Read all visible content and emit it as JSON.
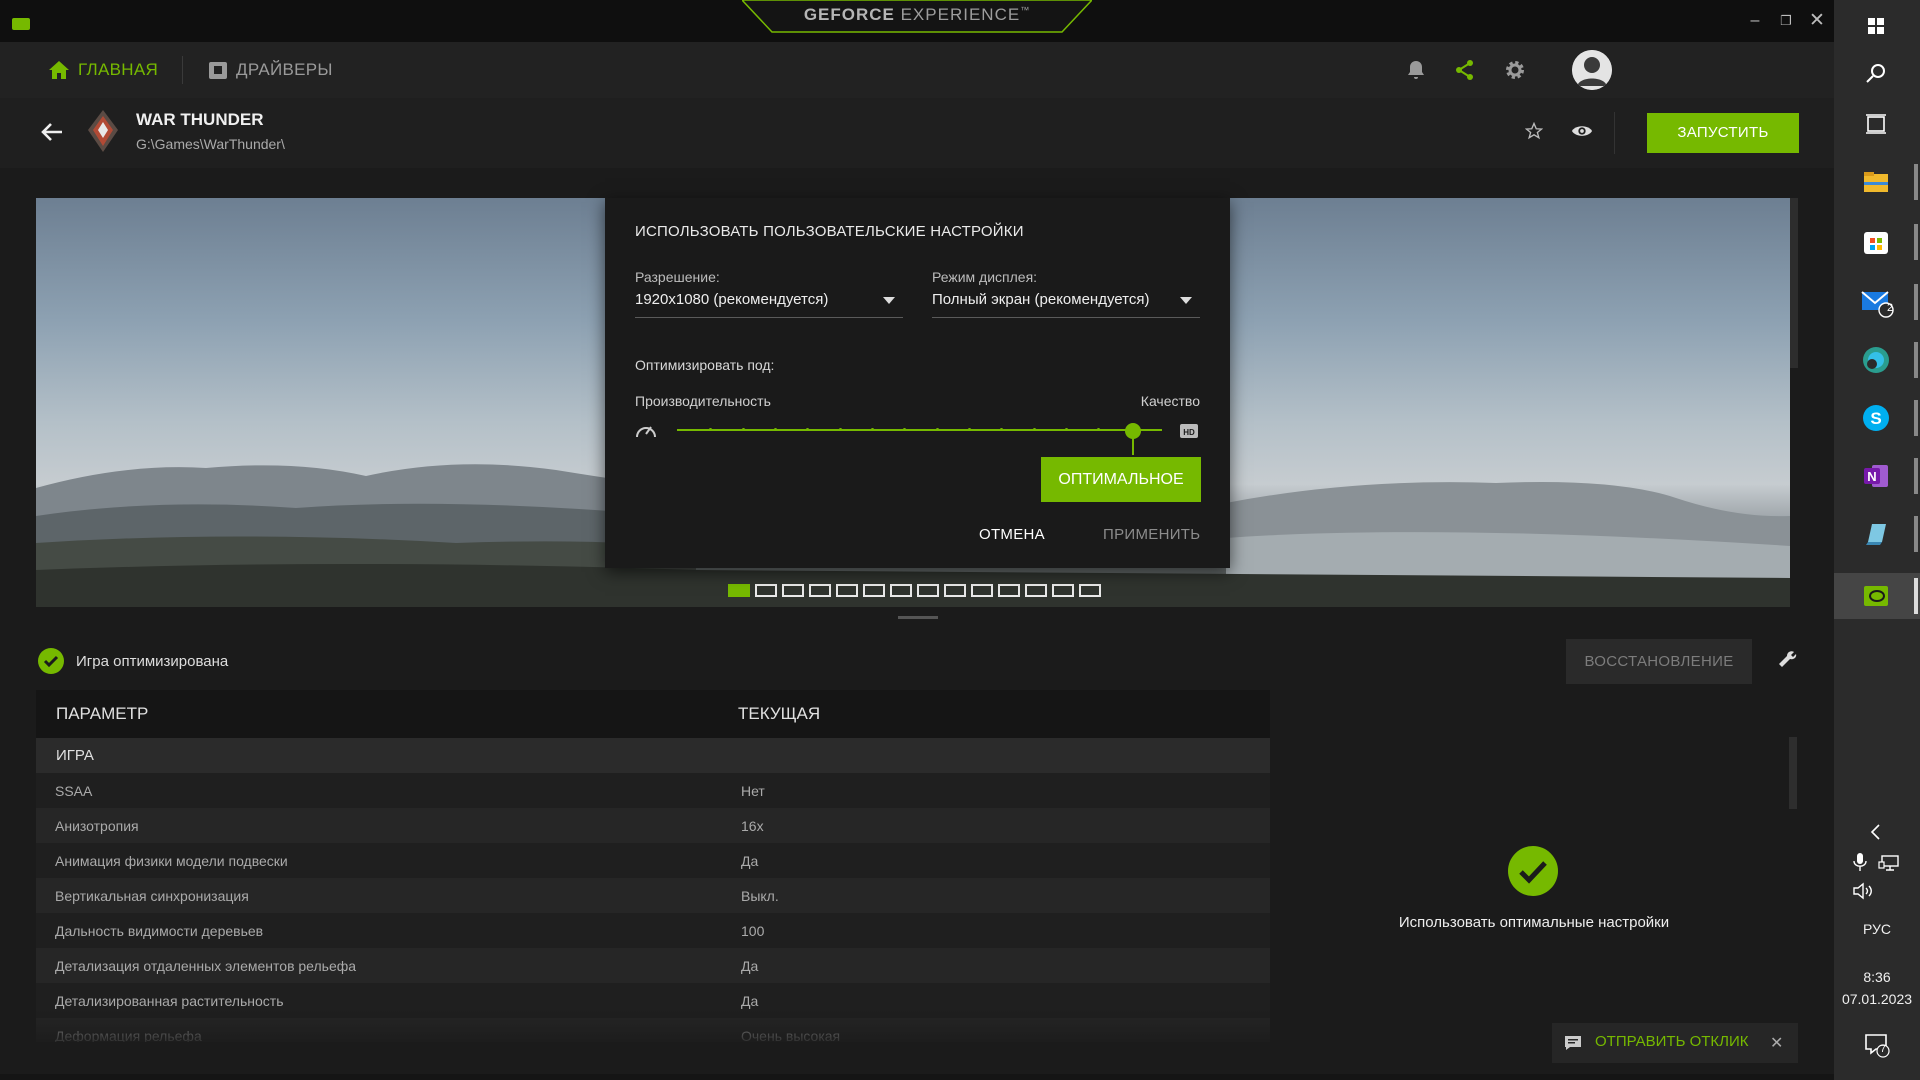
{
  "app": {
    "brand_bold": "GEFORCE",
    "brand_rest": " EXPERIENCE",
    "brand_tm": "™"
  },
  "nav": {
    "home": "ГЛАВНАЯ",
    "drivers": "ДРАЙВЕРЫ"
  },
  "game": {
    "title": "WAR THUNDER",
    "path": "G:\\Games\\WarThunder\\",
    "launch": "ЗАПУСТИТЬ"
  },
  "dialog": {
    "title": "ИСПОЛЬЗОВАТЬ ПОЛЬЗОВАТЕЛЬСКИЕ НАСТРОЙКИ",
    "resolution_label": "Разрешение:",
    "resolution_value": "1920x1080 (рекомендуется)",
    "display_label": "Режим дисплея:",
    "display_value": "Полный экран (рекомендуется)",
    "optimize_label": "Оптимизировать под:",
    "perf_label": "Производительность",
    "quality_label": "Качество",
    "slider_position": 0.94,
    "optimal_button": "ОПТИМАЛЬНОЕ",
    "cancel": "ОТМЕНА",
    "apply": "ПРИМЕНИТЬ"
  },
  "carousel": {
    "count": 14,
    "active": 0
  },
  "status": {
    "text": "Игра оптимизирована",
    "restore": "ВОССТАНОВЛЕНИЕ"
  },
  "table": {
    "col_param": "ПАРАМЕТР",
    "col_current": "ТЕКУЩАЯ",
    "group": "ИГРА",
    "rows": [
      {
        "name": "SSAA",
        "value": "Нет"
      },
      {
        "name": "Анизотропия",
        "value": "16x"
      },
      {
        "name": "Анимация физики модели подвески",
        "value": "Да"
      },
      {
        "name": "Вертикальная синхронизация",
        "value": "Выкл."
      },
      {
        "name": "Дальность видимости деревьев",
        "value": "100"
      },
      {
        "name": "Детализация отдаленных элементов рельефа",
        "value": "Да"
      },
      {
        "name": "Детализированная растительность",
        "value": "Да"
      },
      {
        "name": "Деформация рельефа",
        "value": "Очень высокая"
      }
    ]
  },
  "optimal_panel": {
    "text": "Использовать оптимальные настройки"
  },
  "feedback": {
    "label": "ОТПРАВИТЬ ОТКЛИК"
  },
  "taskbar": {
    "lang": "РУС",
    "time": "8:36",
    "date": "07.01.2023",
    "mail_badge": "2",
    "notif_badge": "7"
  },
  "colors": {
    "accent": "#76b900",
    "bg": "#1b1b1b"
  }
}
